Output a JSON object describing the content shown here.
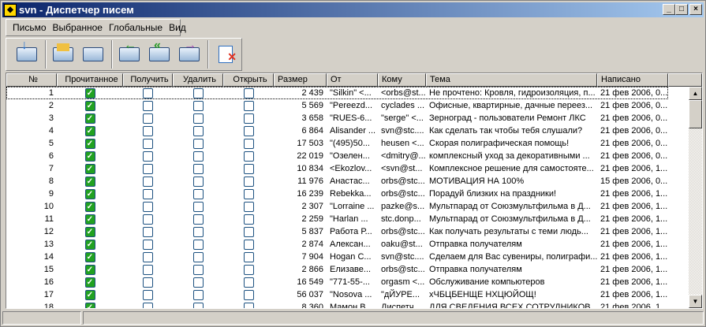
{
  "window": {
    "title": "svn - Диспетчер писем"
  },
  "menu": [
    "Письмо",
    "Выбранное",
    "Глобальные",
    "Вид"
  ],
  "toolbar": [
    {
      "name": "receive-mail",
      "overlay": "↓",
      "color": "#1f6fd0"
    },
    {
      "name": "new-mail",
      "overlay": "",
      "color": "#f0c040"
    },
    {
      "name": "open-mail",
      "overlay": "",
      "color": "#5a8ad0"
    },
    {
      "name": "reply",
      "overlay": "←",
      "color": "#2a9a2a"
    },
    {
      "name": "reply-all",
      "overlay": "«",
      "color": "#2a9a2a"
    },
    {
      "name": "forward",
      "overlay": "→",
      "color": "#a050b0"
    },
    {
      "name": "delete",
      "overlay": "✕",
      "color": "#e03020"
    }
  ],
  "columns": [
    "№",
    "Прочитанное",
    "Получить",
    "Удалить",
    "Открыть",
    "Размер",
    "От",
    "Кому",
    "Тема",
    "Написано"
  ],
  "rows": [
    [
      "1",
      "2 439",
      "\"Silkin\" <...",
      "<orbs@st...",
      "Не прочтено: Кровля, гидроизоляция, п...",
      "21 фев 2006, 0..."
    ],
    [
      "2",
      "5 569",
      "\"Pereezd...",
      "cyclades ...",
      "Офисные, квартирные, дачные переез...",
      "21 фев 2006, 0..."
    ],
    [
      "3",
      "3 658",
      "\"RUES-6...",
      "\"serge\" <...",
      "Зерноград - пользователи Ремонт ЛКС",
      "21 фев 2006, 0..."
    ],
    [
      "4",
      "6 864",
      "Alisander ...",
      "svn@stc....",
      "Как сделать так чтобы тебя слушали?",
      "21 фев 2006, 0..."
    ],
    [
      "5",
      "17 503",
      "\"(495)50...",
      "heusen <...",
      "Скорая полиграфическая помощь!",
      "21 фев 2006, 0..."
    ],
    [
      "6",
      "22 019",
      "\"Озелен...",
      "<dmitry@...",
      "комплексный уход за декоративными ...",
      "21 фев 2006, 0..."
    ],
    [
      "7",
      "10 834",
      "<Ekozlov...",
      "<svn@st...",
      "Комплексное решение для самостояте...",
      "21 фев 2006, 1..."
    ],
    [
      "8",
      "11 976",
      "Анастас...",
      "orbs@stc...",
      "МОТИВАЦИЯ НА 100%",
      "15 фев 2006, 0..."
    ],
    [
      "9",
      "16 239",
      "Rebekka...",
      "orbs@stc...",
      "Порадуй близких на праздники!",
      "21 фев 2006, 1..."
    ],
    [
      "10",
      "2 307",
      "\"Lorraine ...",
      "pazke@s...",
      "Мультпарад от Союзмультфильма в Д...",
      "21 фев 2006, 1..."
    ],
    [
      "11",
      "2 259",
      "\"Harlan ...",
      "stc.donp...",
      "Мультпарад от Союзмультфильма в Д...",
      "21 фев 2006, 1..."
    ],
    [
      "12",
      "5 837",
      "Работа Р...",
      "orbs@stc...",
      "Как получать результаты с теми людь...",
      "21 фев 2006, 1..."
    ],
    [
      "13",
      "2 874",
      "Алексан...",
      "oaku@st...",
      "Отправка получателям",
      "21 фев 2006, 1..."
    ],
    [
      "14",
      "7 904",
      "Hogan C...",
      "svn@stc....",
      "Сделаем для Вас сувениры, полиграфи...",
      "21 фев 2006, 1..."
    ],
    [
      "15",
      "2 866",
      "Елизаве...",
      "orbs@stc...",
      "Отправка получателям",
      "21 фев 2006, 1..."
    ],
    [
      "16",
      "16 549",
      "\"771-55-...",
      "orgasm <...",
      "Обслуживание компьютеров",
      "21 фев 2006, 1..."
    ],
    [
      "17",
      "56 037",
      "\"Nosova ...",
      "\"дЙУРЕ...",
      "хЧБЦБЕНЩЕ НХЦЮЙОЩ!",
      "21 фев 2006, 1..."
    ],
    [
      "18",
      "8 360",
      "Мамон В...",
      "Диспетч...",
      "ДЛЯ СВЕДЕНИЯ ВСЕХ СОТРУДНИКОВ",
      "21 фев 2006, 1..."
    ]
  ]
}
